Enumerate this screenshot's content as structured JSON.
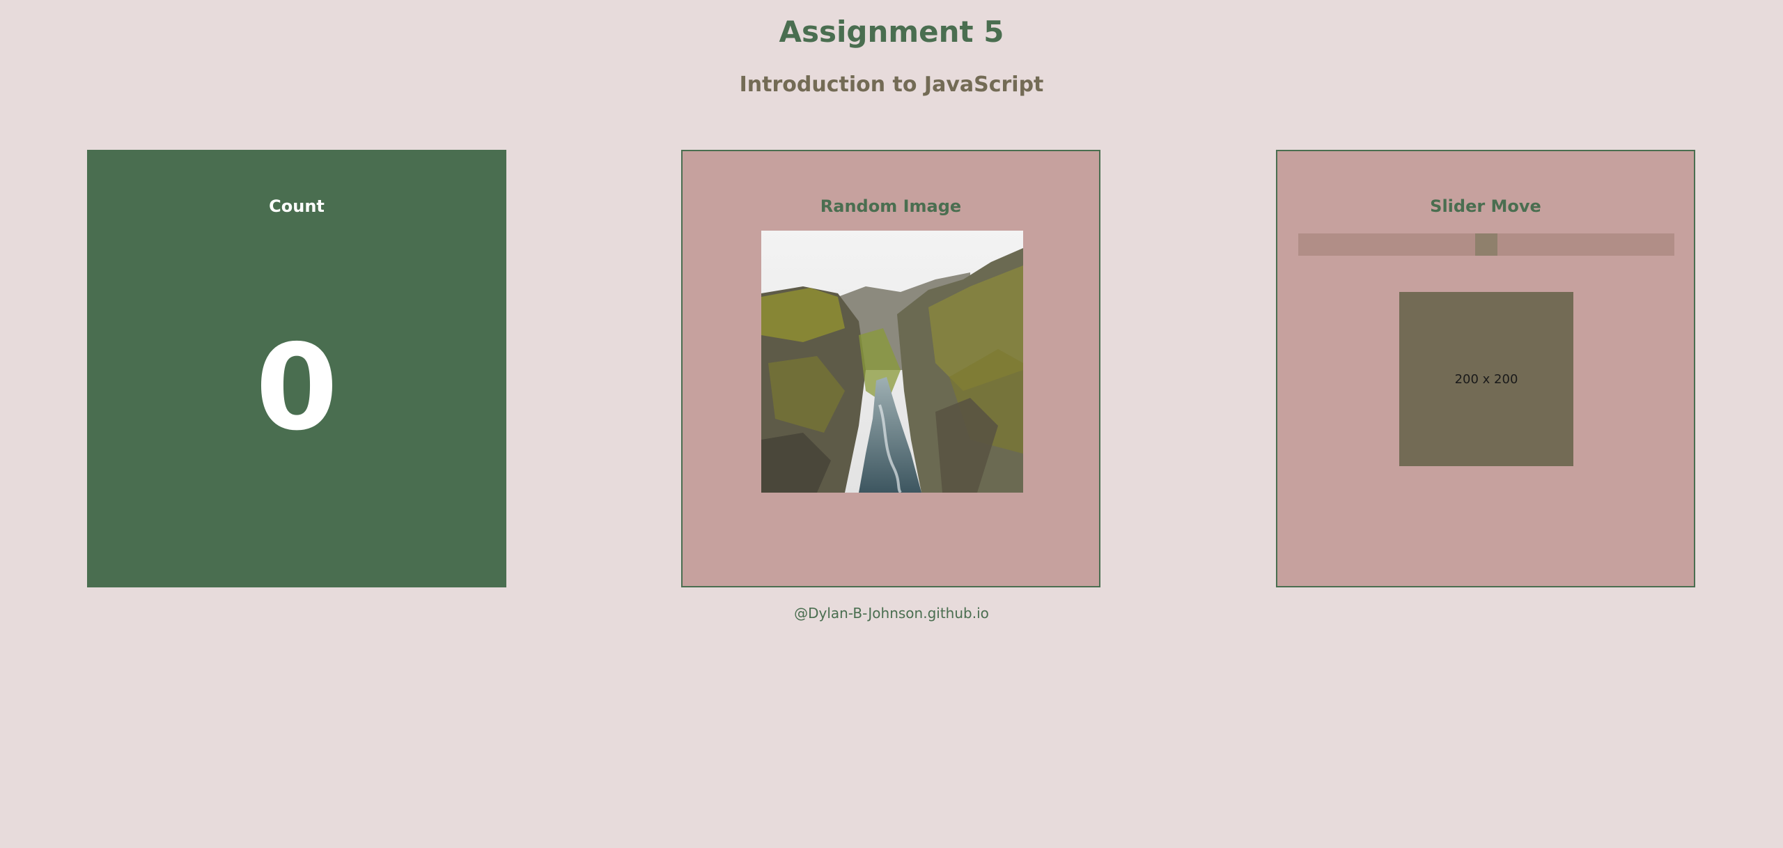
{
  "header": {
    "title": "Assignment 5",
    "subtitle": "Introduction to JavaScript"
  },
  "count_panel": {
    "heading": "Count",
    "value": "0"
  },
  "image_panel": {
    "heading": "Random Image",
    "image_alt": "Random Image"
  },
  "slider_panel": {
    "heading": "Slider Move",
    "slider_value_percent": 50,
    "box_label": "200 x 200"
  },
  "footer": {
    "link_text": "@Dylan-B-Johnson.github.io"
  },
  "colors": {
    "background": "#e7dbdb",
    "green": "#4a6e50",
    "rose": "#c6a19e",
    "olive": "#736b55",
    "slider_track": "#b18e87",
    "slider_thumb": "#8f806c"
  }
}
